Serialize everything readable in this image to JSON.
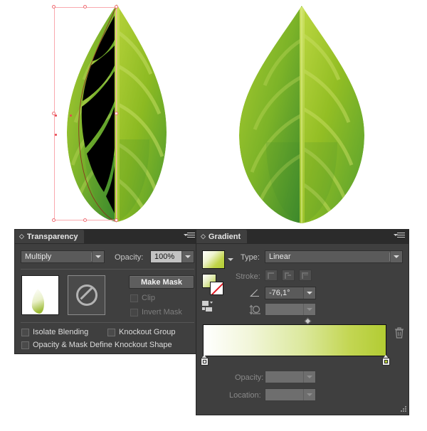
{
  "app": {
    "title": "Adobe Illustrator artwork with Transparency and Gradient panels"
  },
  "artwork": {
    "left_leaf": {
      "name": "leaf-with-black-mask-shape",
      "description": "Green gradient leaf with a black opacity-mask shape covering the left half of the blade and selection bounding box",
      "leaf_green_light": "#A9CB2F",
      "leaf_green_mid": "#8CBA22",
      "leaf_green_dark": "#4E9B2F",
      "mask_shape_color": "#000000",
      "selection_color": "#F7A6AB",
      "anchor_color": "#E8454F"
    },
    "right_leaf": {
      "name": "leaf-result",
      "description": "Finished green gradient leaf without the black mask shape",
      "leaf_green_light": "#A9CB2F",
      "leaf_green_mid": "#8CBA22",
      "leaf_green_dark": "#4E9B2F"
    }
  },
  "transparency_panel": {
    "tab_label": "Transparency",
    "grip_icon": "diamond-grip-icon",
    "menu_icon": "panel-menu-icon",
    "blend_mode": {
      "label": "",
      "value": "Multiply",
      "icon": "chevron-down-icon"
    },
    "opacity": {
      "label": "Opacity:",
      "value": "100%",
      "icon": "chevron-down-icon"
    },
    "object_thumbnail": {
      "name": "object-thumbnail",
      "description": "white thumbnail with pale green leaf"
    },
    "mask_thumbnail": {
      "name": "mask-thumbnail",
      "icon": "no-mask-icon"
    },
    "make_mask_button": "Make Mask",
    "clip_checkbox": {
      "label": "Clip",
      "checked": false,
      "enabled": false
    },
    "invert_mask_checkbox": {
      "label": "Invert Mask",
      "checked": false,
      "enabled": false
    },
    "isolate_blending_checkbox": {
      "label": "Isolate Blending",
      "checked": false,
      "enabled": true
    },
    "knockout_group_checkbox": {
      "label": "Knockout Group",
      "checked": false,
      "enabled": true
    },
    "opacity_mask_knockout_checkbox": {
      "label": "Opacity & Mask Define Knockout Shape",
      "checked": false,
      "enabled": true
    }
  },
  "gradient_panel": {
    "tab_label": "Gradient",
    "grip_icon": "diamond-grip-icon",
    "menu_icon": "panel-menu-icon",
    "gradient_swatch": {
      "name": "gradient-preview-swatch",
      "start_color": "#FFFFFF",
      "end_color": "#B2CC33",
      "dropdown_icon": "chevron-down-icon"
    },
    "fill_stroke": {
      "fill_name": "fill-swatch",
      "stroke_name": "stroke-swatch-none",
      "stroke_icon": "none-slash-icon"
    },
    "reverse_gradient_icon": "reverse-gradient-icon",
    "type": {
      "label": "Type:",
      "value": "Linear",
      "icon": "chevron-down-icon"
    },
    "stroke": {
      "label": "Stroke:",
      "buttons": [
        "stroke-gradient-within",
        "stroke-gradient-along",
        "stroke-gradient-across"
      ],
      "enabled": false
    },
    "angle": {
      "icon": "angle-icon",
      "value": "-76,1°",
      "dropdown_icon": "chevron-down-icon"
    },
    "aspect_ratio": {
      "icon": "aspect-ratio-icon",
      "value": "",
      "enabled": false,
      "dropdown_icon": "chevron-down-icon"
    },
    "gradient_slider": {
      "name": "gradient-ramp",
      "start_color": "#FFFFFF",
      "end_color": "#B2CC33",
      "midpoint_icon": "gradient-midpoint-diamond",
      "stops": [
        {
          "position": 0,
          "color": "#FFFFFF",
          "label": "gradient-stop-start"
        },
        {
          "position": 100,
          "color": "#B2CC33",
          "label": "gradient-stop-end"
        }
      ]
    },
    "delete_stop_icon": "trash-icon",
    "opacity": {
      "label": "Opacity:",
      "value": "",
      "enabled": false,
      "icon": "chevron-down-icon"
    },
    "location": {
      "label": "Location:",
      "value": "",
      "enabled": false,
      "icon": "chevron-down-icon"
    },
    "resize_grip_icon": "resize-grip-icon"
  }
}
